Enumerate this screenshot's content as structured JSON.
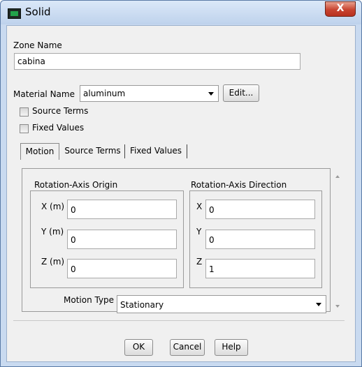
{
  "window": {
    "title": "Solid",
    "close_glyph": "X"
  },
  "zone": {
    "label": "Zone Name",
    "value": "cabina"
  },
  "material": {
    "label": "Material Name",
    "selected": "aluminum",
    "edit_label": "Edit..."
  },
  "checkboxes": [
    {
      "label": "Source Terms",
      "checked": false
    },
    {
      "label": "Fixed Values",
      "checked": false
    }
  ],
  "tabs": [
    {
      "label": "Motion",
      "active": true
    },
    {
      "label": "Source Terms",
      "active": false
    },
    {
      "label": "Fixed Values",
      "active": false
    }
  ],
  "motion": {
    "origin": {
      "title": "Rotation-Axis Origin",
      "fields": [
        {
          "label": "X (m)",
          "value": "0"
        },
        {
          "label": "Y (m)",
          "value": "0"
        },
        {
          "label": "Z (m)",
          "value": "0"
        }
      ]
    },
    "direction": {
      "title": "Rotation-Axis Direction",
      "fields": [
        {
          "label": "X",
          "value": "0"
        },
        {
          "label": "Y",
          "value": "0"
        },
        {
          "label": "Z",
          "value": "1"
        }
      ]
    },
    "motion_type": {
      "label": "Motion Type",
      "selected": "Stationary"
    }
  },
  "buttons": {
    "ok": "OK",
    "cancel": "Cancel",
    "help": "Help"
  },
  "icons": {
    "app": "fluent-app-icon",
    "close": "close-icon",
    "dropdown": "chevron-down-icon"
  }
}
